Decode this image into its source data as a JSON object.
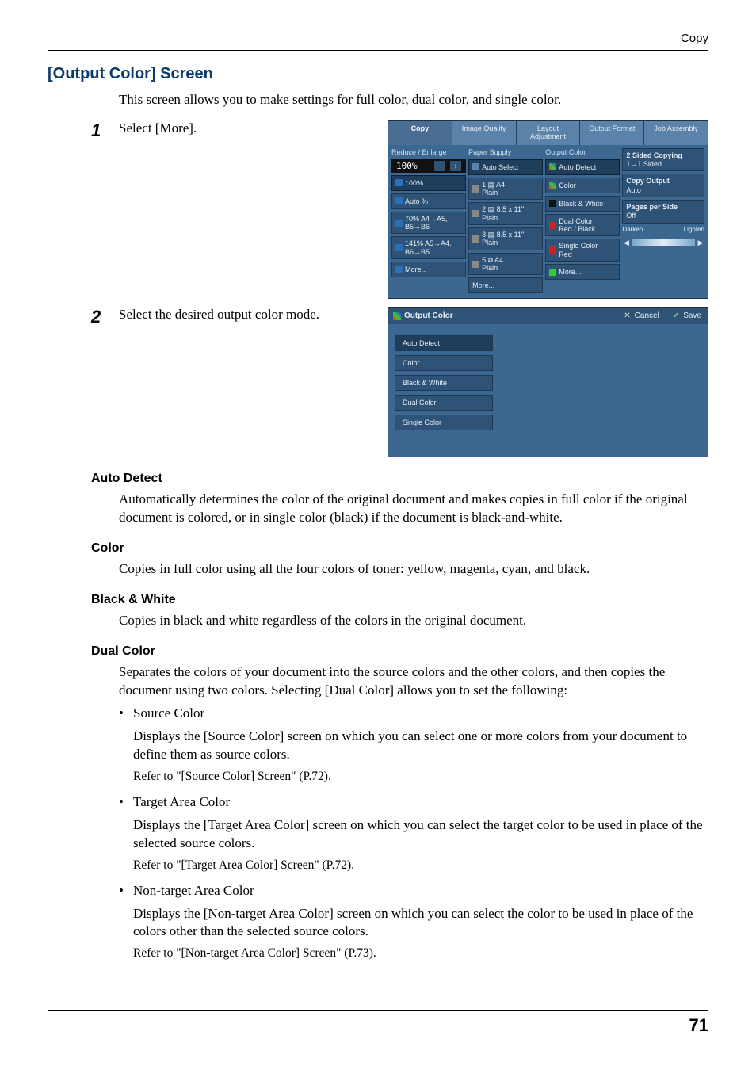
{
  "header": {
    "category": "Copy"
  },
  "section": {
    "title": "[Output Color] Screen"
  },
  "intro": "This screen allows you to make settings for full color, dual color, and single color.",
  "steps": [
    {
      "num": "1",
      "text": "Select [More]."
    },
    {
      "num": "2",
      "text": "Select the desired output color mode."
    }
  ],
  "fig1": {
    "tabs": [
      "Copy",
      "Image Quality",
      "Layout\nAdjustment",
      "Output Format",
      "Job Assembly"
    ],
    "col_reduce": {
      "head": "Reduce / Enlarge",
      "zoom": "100%",
      "items": [
        "100%",
        "Auto %",
        "70% A4→A5,\nB5→B6",
        "141% A5→A4,\nB6→B5",
        "More..."
      ]
    },
    "col_paper": {
      "head": "Paper Supply",
      "items": [
        "Auto Select",
        "1 ▤ A4\nPlain",
        "2 ▤ 8.5 x 11\"\nPlain",
        "3 ▤ 8.5 x 11\"\nPlain",
        "5 ⧉ A4\nPlain",
        "More..."
      ]
    },
    "col_output": {
      "head": "Output Color",
      "items": [
        "Auto Detect",
        "Color",
        "Black & White",
        "Dual Color\nRed / Black",
        "Single Color\nRed",
        "More..."
      ]
    },
    "col_side": {
      "two_sided": {
        "head": "2 Sided Copying",
        "value": "1→1 Sided"
      },
      "copy_output": {
        "head": "Copy Output",
        "value": "Auto"
      },
      "pages_per_side": {
        "head": "Pages per Side",
        "value": "Off"
      },
      "darken": "Darken",
      "lighten": "Lighten"
    }
  },
  "fig2": {
    "title": "Output Color",
    "cancel": "Cancel",
    "save": "Save",
    "options": [
      "Auto Detect",
      "Color",
      "Black & White",
      "Dual Color",
      "Single Color"
    ]
  },
  "sub": {
    "auto_detect": {
      "head": "Auto Detect",
      "body": "Automatically determines the color of the original document and makes copies in full color if the original document is colored, or in single color (black) if the document is black-and-white."
    },
    "color": {
      "head": "Color",
      "body": "Copies in full color using all the four colors of toner: yellow, magenta, cyan, and black."
    },
    "bw": {
      "head": "Black & White",
      "body": "Copies in black and white regardless of the colors in the original document."
    },
    "dual": {
      "head": "Dual Color",
      "body": "Separates the colors of your document into the source colors and the other colors, and then copies the document using two colors. Selecting [Dual Color] allows you to set the following:",
      "bullets": [
        {
          "label": "Source Color",
          "desc": "Displays the [Source Color] screen on which you can select one or more colors from your document to define them as source colors.",
          "ref": "Refer to \"[Source Color] Screen\" (P.72)."
        },
        {
          "label": "Target Area Color",
          "desc": "Displays the [Target Area Color] screen on which you can select the target color to be used in place of the selected source colors.",
          "ref": "Refer to \"[Target Area Color] Screen\" (P.72)."
        },
        {
          "label": "Non-target Area Color",
          "desc": "Displays the [Non-target Area Color] screen on which you can select the color to be used in place of the colors other than the selected source colors.",
          "ref": "Refer to \"[Non-target Area Color] Screen\" (P.73)."
        }
      ]
    }
  },
  "page_number": "71"
}
